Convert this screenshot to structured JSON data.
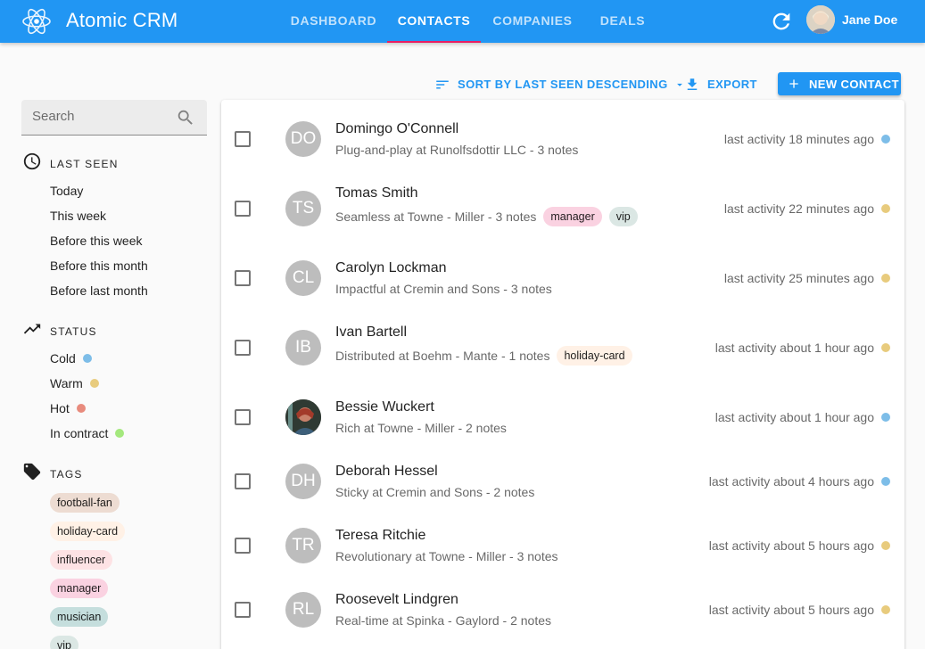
{
  "app": {
    "title": "Atomic CRM"
  },
  "nav": {
    "tabs": [
      {
        "label": "DASHBOARD"
      },
      {
        "label": "CONTACTS"
      },
      {
        "label": "COMPANIES"
      },
      {
        "label": "DEALS"
      }
    ],
    "active_tab": "CONTACTS"
  },
  "user": {
    "name": "Jane Doe"
  },
  "colors": {
    "primary": "#2196f3",
    "accent": "#e91e63",
    "cold": "#7dbde8",
    "warm": "#e8cb7d",
    "hot": "#e88b7d",
    "in_contract": "#a4e87d"
  },
  "toolbar": {
    "sort_label": "SORT BY LAST SEEN DESCENDING",
    "export_label": "EXPORT",
    "new_contact_label": "NEW CONTACT"
  },
  "sidebar": {
    "search_placeholder": "Search",
    "last_seen": {
      "title": "LAST SEEN",
      "items": [
        "Today",
        "This week",
        "Before this week",
        "Before this month",
        "Before last month"
      ]
    },
    "status": {
      "title": "STATUS",
      "items": [
        {
          "label": "Cold",
          "color": "#7dbde8"
        },
        {
          "label": "Warm",
          "color": "#e8cb7d"
        },
        {
          "label": "Hot",
          "color": "#e88b7d"
        },
        {
          "label": "In contract",
          "color": "#a4e87d"
        }
      ]
    },
    "tags": {
      "title": "TAGS",
      "items": [
        {
          "label": "football-fan",
          "color": "#eddcd2"
        },
        {
          "label": "holiday-card",
          "color": "#fff1e6"
        },
        {
          "label": "influencer",
          "color": "#fde2e4"
        },
        {
          "label": "manager",
          "color": "#fad2e1"
        },
        {
          "label": "musician",
          "color": "#c5dedd"
        },
        {
          "label": "vip",
          "color": "#dbe7e4"
        }
      ]
    }
  },
  "contacts": [
    {
      "initials": "DO",
      "name": "Domingo O'Connell",
      "subtitle": "Plug-and-play at Runolfsdottir LLC - 3 notes",
      "tags": [],
      "activity": "last activity 18 minutes ago",
      "status_color": "#7dbde8"
    },
    {
      "initials": "TS",
      "name": "Tomas Smith",
      "subtitle": "Seamless at Towne - Miller - 3 notes",
      "tags": [
        {
          "label": "manager",
          "color": "#fad2e1"
        },
        {
          "label": "vip",
          "color": "#dbe7e4"
        }
      ],
      "activity": "last activity 22 minutes ago",
      "status_color": "#e8cb7d"
    },
    {
      "initials": "CL",
      "name": "Carolyn Lockman",
      "subtitle": "Impactful at Cremin and Sons - 3 notes",
      "tags": [],
      "activity": "last activity 25 minutes ago",
      "status_color": "#e8cb7d"
    },
    {
      "initials": "IB",
      "name": "Ivan Bartell",
      "subtitle": "Distributed at Boehm - Mante - 1 notes",
      "tags": [
        {
          "label": "holiday-card",
          "color": "#fff1e6"
        }
      ],
      "activity": "last activity about 1 hour ago",
      "status_color": "#e8cb7d"
    },
    {
      "initials": "",
      "name": "Bessie Wuckert",
      "subtitle": "Rich at Towne - Miller - 2 notes",
      "tags": [],
      "activity": "last activity about 1 hour ago",
      "status_color": "#7dbde8"
    },
    {
      "initials": "DH",
      "name": "Deborah Hessel",
      "subtitle": "Sticky at Cremin and Sons - 2 notes",
      "tags": [],
      "activity": "last activity about 4 hours ago",
      "status_color": "#7dbde8"
    },
    {
      "initials": "TR",
      "name": "Teresa Ritchie",
      "subtitle": "Revolutionary at Towne - Miller - 3 notes",
      "tags": [],
      "activity": "last activity about 5 hours ago",
      "status_color": "#e8cb7d"
    },
    {
      "initials": "RL",
      "name": "Roosevelt Lindgren",
      "subtitle": "Real-time at Spinka - Gaylord - 2 notes",
      "tags": [],
      "activity": "last activity about 5 hours ago",
      "status_color": "#e8cb7d"
    }
  ]
}
